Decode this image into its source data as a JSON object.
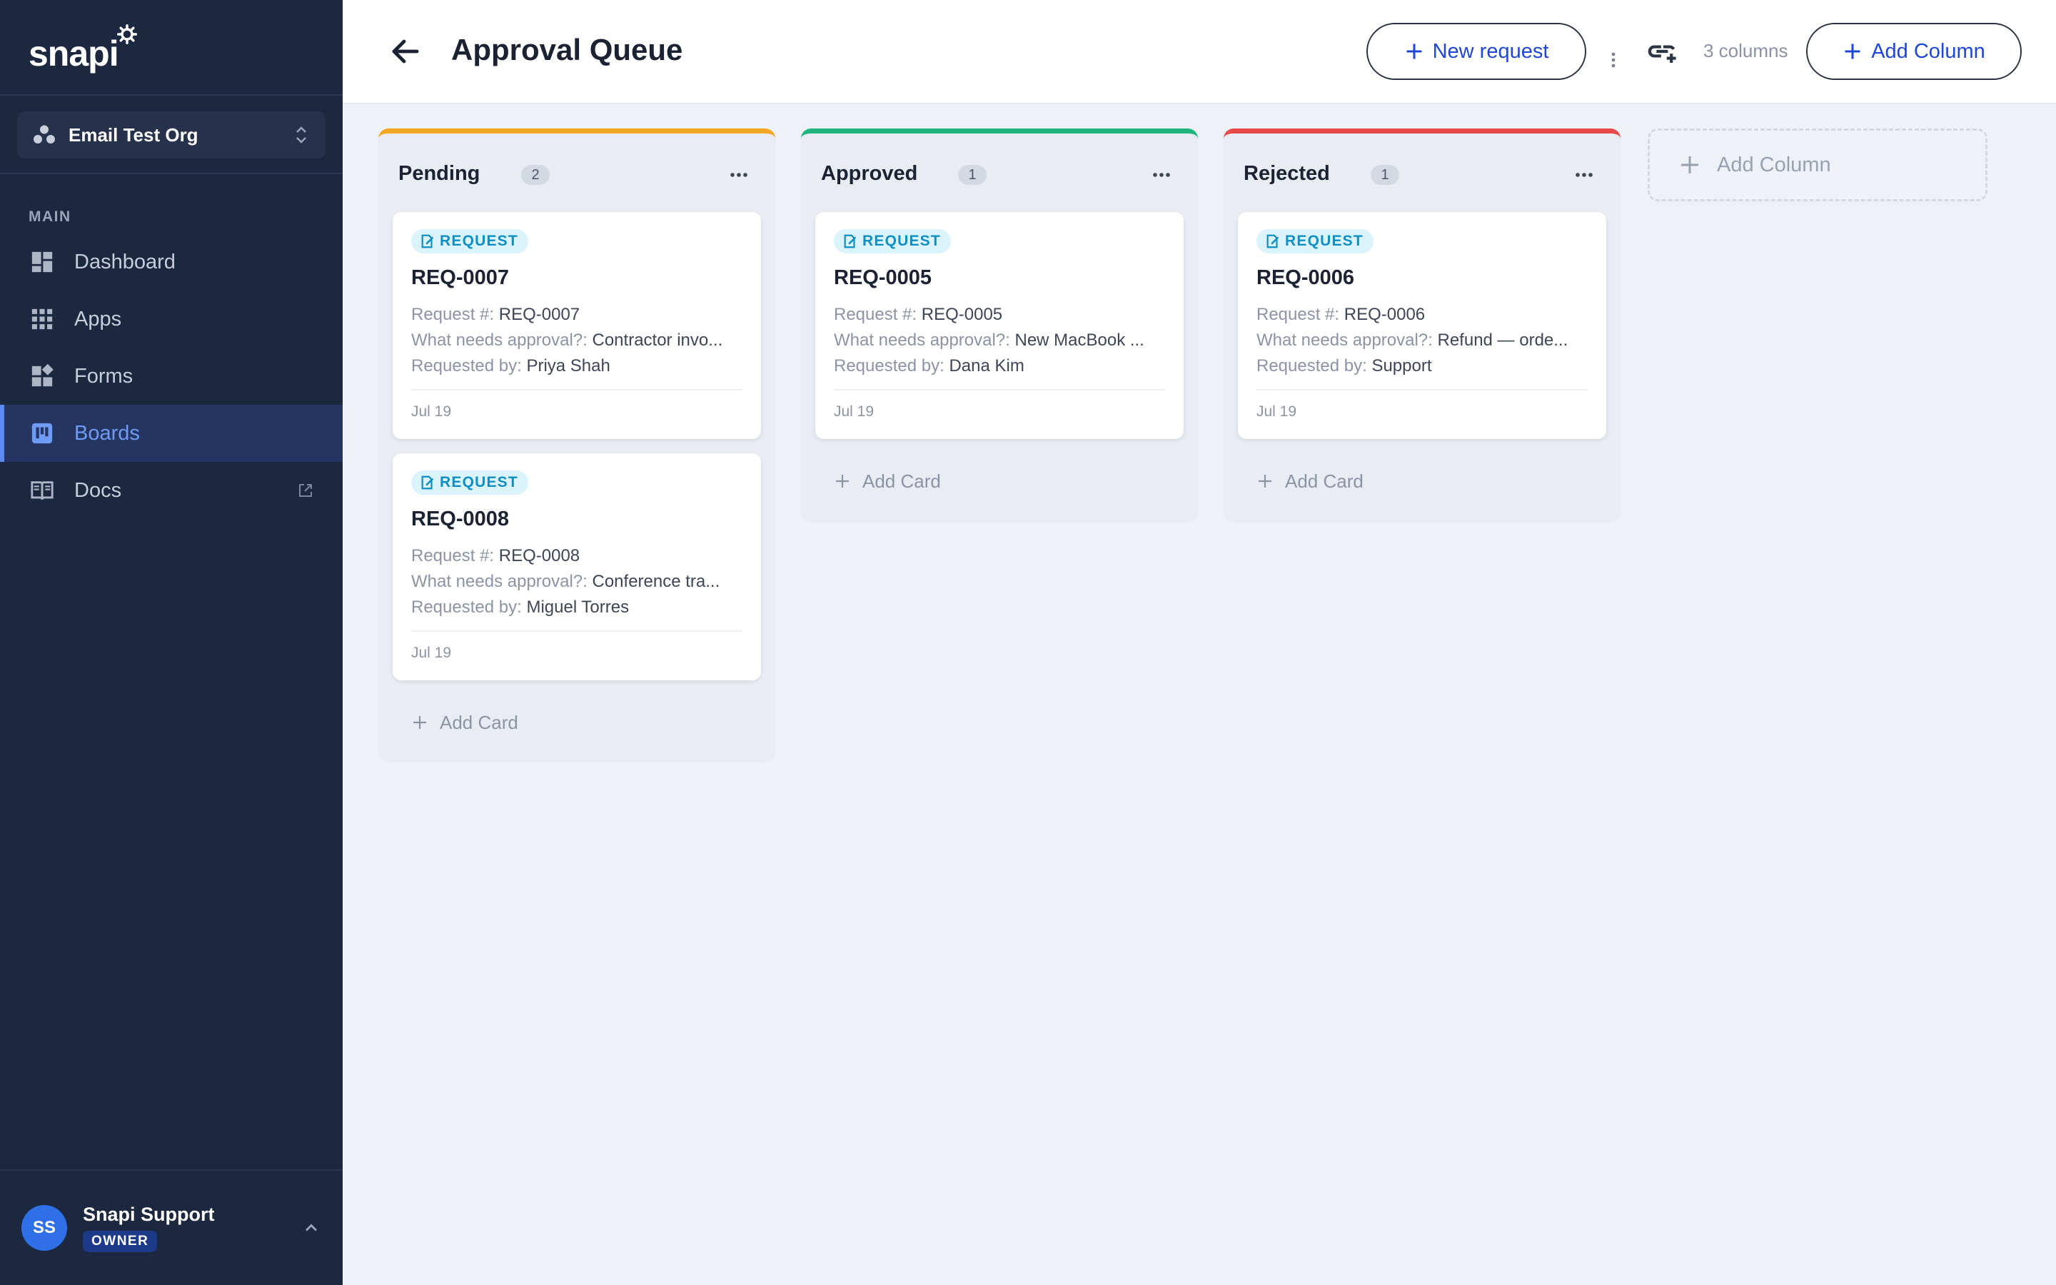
{
  "sidebar": {
    "logo": "snapi",
    "org_name": "Email Test Org",
    "section_label": "MAIN",
    "items": [
      {
        "label": "Dashboard"
      },
      {
        "label": "Apps"
      },
      {
        "label": "Forms"
      },
      {
        "label": "Boards"
      },
      {
        "label": "Docs"
      }
    ],
    "user": {
      "initials": "SS",
      "name": "Snapi Support",
      "role": "OWNER"
    }
  },
  "header": {
    "title": "Approval Queue",
    "new_request_label": "New request",
    "column_count": "3 columns",
    "add_column_label": "Add Column"
  },
  "board": {
    "columns": [
      {
        "title": "Pending",
        "count": "2",
        "accent": "#f5a623",
        "add_card_label": "Add Card",
        "cards": [
          {
            "tag": "REQUEST",
            "title": "REQ-0007",
            "req_label": "Request #:",
            "req_value": "REQ-0007",
            "what_label": "What needs approval?:",
            "what_value": "Contractor invo...",
            "by_label": "Requested by:",
            "by_value": "Priya Shah",
            "date": "Jul 19"
          },
          {
            "tag": "REQUEST",
            "title": "REQ-0008",
            "req_label": "Request #:",
            "req_value": "REQ-0008",
            "what_label": "What needs approval?:",
            "what_value": "Conference tra...",
            "by_label": "Requested by:",
            "by_value": "Miguel Torres",
            "date": "Jul 19"
          }
        ]
      },
      {
        "title": "Approved",
        "count": "1",
        "accent": "#1fb57d",
        "add_card_label": "Add Card",
        "cards": [
          {
            "tag": "REQUEST",
            "title": "REQ-0005",
            "req_label": "Request #:",
            "req_value": "REQ-0005",
            "what_label": "What needs approval?:",
            "what_value": "New MacBook ...",
            "by_label": "Requested by:",
            "by_value": "Dana Kim",
            "date": "Jul 19"
          }
        ]
      },
      {
        "title": "Rejected",
        "count": "1",
        "accent": "#e84a4a",
        "add_card_label": "Add Card",
        "cards": [
          {
            "tag": "REQUEST",
            "title": "REQ-0006",
            "req_label": "Request #:",
            "req_value": "REQ-0006",
            "what_label": "What needs approval?:",
            "what_value": "Refund — orde...",
            "by_label": "Requested by:",
            "by_value": "Support",
            "date": "Jul 19"
          }
        ]
      }
    ],
    "ghost_add_column_label": "Add Column"
  },
  "colors": {
    "sidebar_bg": "#1c2740",
    "accent_blue": "#1f46d6",
    "active_nav": "#6f9bf5",
    "tag_cyan": "#0f8fc2"
  },
  "icons": [
    "gear-icon",
    "org-icon",
    "chevron-updown-icon",
    "dashboard-icon",
    "apps-grid-icon",
    "forms-icon",
    "boards-icon",
    "docs-book-icon",
    "external-link-icon",
    "chevron-up-icon",
    "back-arrow-icon",
    "plus-icon",
    "kebab-vertical-icon",
    "link-add-icon",
    "ellipsis-icon",
    "file-edit-icon"
  ]
}
